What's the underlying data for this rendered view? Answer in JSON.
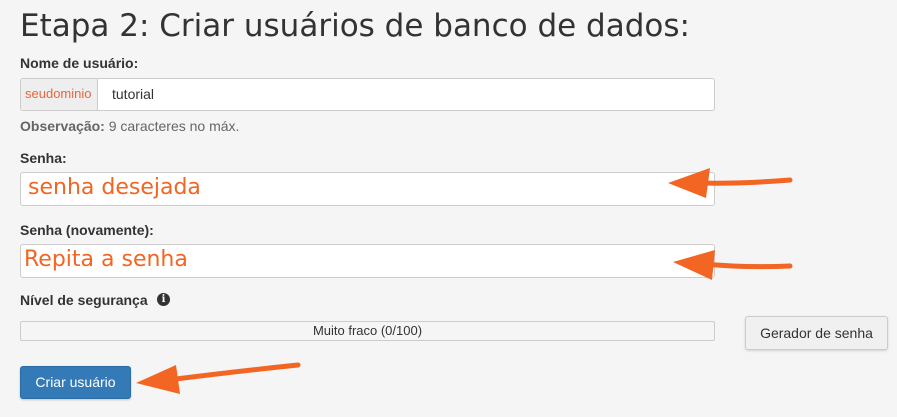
{
  "title": "Etapa 2: Criar usuários de banco de dados:",
  "username": {
    "label": "Nome de usuário:",
    "prefix": "seudominio",
    "value": "tutorial"
  },
  "note": {
    "bold": "Observação:",
    "text": " 9 caracteres no máx."
  },
  "password": {
    "label": "Senha:",
    "value": "senha desejada"
  },
  "password_again": {
    "label": "Senha (novamente):",
    "value": "Repita a senha"
  },
  "strength": {
    "label": "Nível de segurança",
    "info_icon": "info-circle-icon",
    "status": "Muito fraco (0/100)",
    "value": 0
  },
  "buttons": {
    "generator": "Gerador de senha",
    "create": "Criar usuário"
  },
  "colors": {
    "accent_orange": "#f26522",
    "primary_button": "#337ab7"
  }
}
